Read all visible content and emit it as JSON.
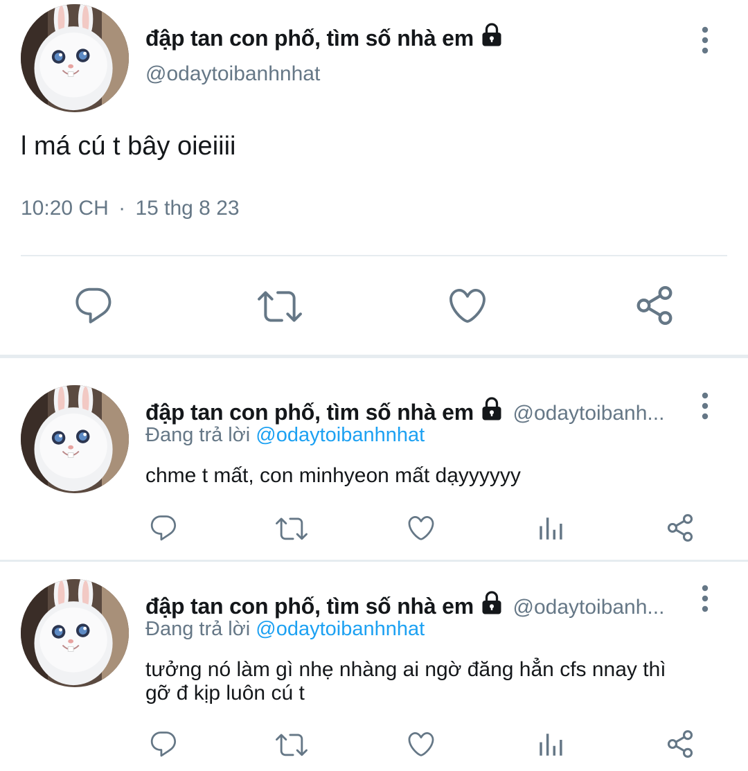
{
  "main_tweet": {
    "display_name": "đập tan con phố, tìm số nhà em",
    "handle": "@odaytoibanhnhat",
    "text": "l má cú t bây oieiiii",
    "time": "10:20 CH",
    "separator": "·",
    "date": "15 thg 8 23"
  },
  "replies": [
    {
      "display_name": "đập tan con phố, tìm số nhà em",
      "handle": "@odaytoibanh...",
      "replying_prefix": "Đang trả lời",
      "replying_to": "@odaytoibanhnhat",
      "text": "chme t mất, con minhyeon mất dạyyyyyy"
    },
    {
      "display_name": "đập tan con phố, tìm số nhà em",
      "handle": "@odaytoibanh...",
      "replying_prefix": "Đang trả lời",
      "replying_to": "@odaytoibanhnhat",
      "text_line1": "tưởng nó làm gì nhẹ nhàng ai ngờ đăng hẳn cfs nnay thì",
      "text_line2": "gỡ đ kịp luôn cú t"
    }
  ],
  "icons": {
    "reply": "reply-icon",
    "retweet": "retweet-icon",
    "like": "like-icon",
    "share": "share-icon",
    "analytics": "analytics-icon",
    "lock": "lock-icon",
    "more": "more-options-icon"
  },
  "colors": {
    "text": "#14171a",
    "secondary": "#657786",
    "mention": "#1da1f2",
    "icon": "#657786",
    "divider": "#e6ecf0"
  }
}
